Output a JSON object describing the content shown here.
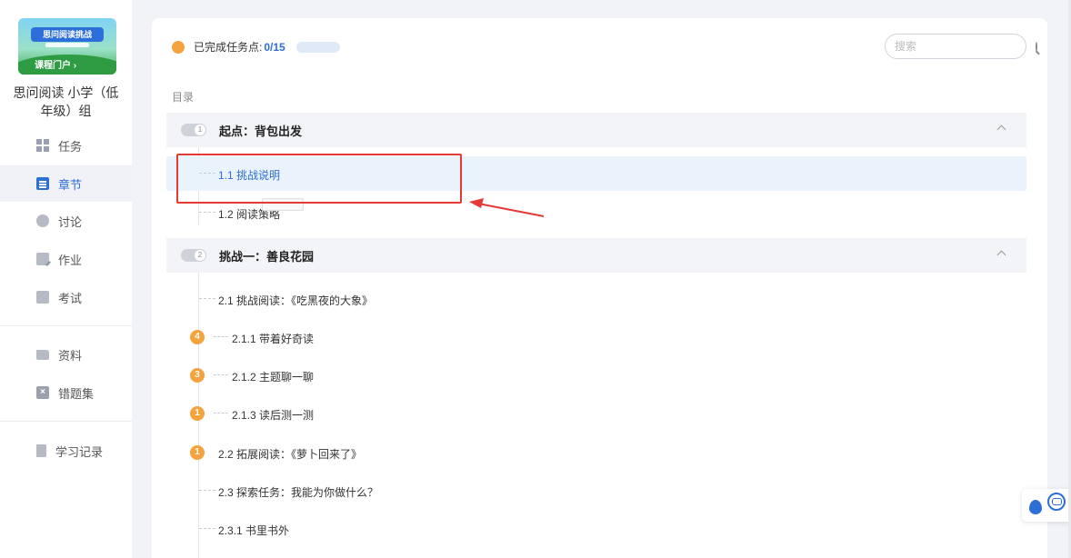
{
  "sidebar": {
    "cover": {
      "title": "思问阅读挑战",
      "portal": "课程门户 ›"
    },
    "course_name": "思问阅读 小学（低年级）组",
    "nav": [
      {
        "label": "任务",
        "icon": "grid-icon"
      },
      {
        "label": "章节",
        "icon": "chapter-icon",
        "active": true
      },
      {
        "label": "讨论",
        "icon": "chat-icon"
      },
      {
        "label": "作业",
        "icon": "homework-icon"
      },
      {
        "label": "考试",
        "icon": "exam-icon"
      },
      {
        "label": "资料",
        "icon": "folder-icon"
      },
      {
        "label": "错题集",
        "icon": "mistakes-icon"
      },
      {
        "label": "学习记录",
        "icon": "record-icon"
      }
    ]
  },
  "header": {
    "progress_label": "已完成任务点:",
    "progress_value": "0/15",
    "progress_fraction": 0,
    "search_placeholder": "搜索"
  },
  "toc": {
    "label": "目录",
    "chapters": [
      {
        "number": "1",
        "title": "起点：背包出发",
        "sections": [
          {
            "title": "1.1 挑战说明",
            "highlight": true
          },
          {
            "title": "1.2 阅读策略"
          }
        ]
      },
      {
        "number": "2",
        "title": "挑战一：善良花园",
        "sections": [
          {
            "title": "2.1 挑战阅读：《吃黑夜的大象》"
          },
          {
            "title": "2.1.1 带着好奇读",
            "badge": "4"
          },
          {
            "title": "2.1.2 主题聊一聊",
            "badge": "3"
          },
          {
            "title": "2.1.3 读后测一测",
            "badge": "1"
          },
          {
            "title": "2.2 拓展阅读：《萝卜回来了》",
            "badge": "1"
          },
          {
            "title": "2.3 探索任务：我能为你做什么？"
          },
          {
            "title": "2.3.1 书里书外"
          }
        ]
      }
    ]
  },
  "colors": {
    "accent": "#2d6fd8",
    "badge": "#f5a33d",
    "annotation": "#e53935"
  }
}
